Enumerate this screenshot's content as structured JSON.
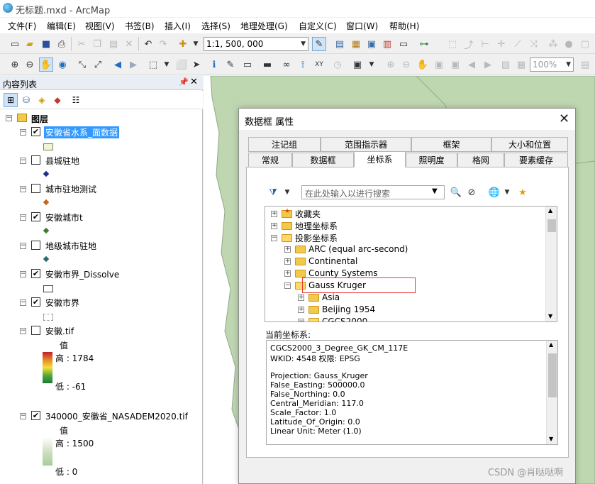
{
  "window": {
    "title": "无标题.mxd - ArcMap"
  },
  "menu": [
    "文件(F)",
    "编辑(E)",
    "视图(V)",
    "书签(B)",
    "插入(I)",
    "选择(S)",
    "地理处理(G)",
    "自定义(C)",
    "窗口(W)",
    "帮助(H)"
  ],
  "toolbar": {
    "scale": "1:1, 500, 000",
    "zoom_percent": "100%"
  },
  "toc": {
    "title": "内容列表",
    "root": "图层",
    "layers": [
      {
        "name": "安徽省水系_面数据",
        "checked": "✔",
        "selected": true
      },
      {
        "name": "县城驻地",
        "checked": ""
      },
      {
        "name": "城市驻地测试",
        "checked": ""
      },
      {
        "name": "安徽城市t",
        "checked": "✔"
      },
      {
        "name": "地级城市驻地",
        "checked": ""
      },
      {
        "name": "安徽市界_Dissolve",
        "checked": "✔"
      },
      {
        "name": "安徽市界",
        "checked": "✔"
      },
      {
        "name": "安徽.tif",
        "checked": "",
        "value_label": "值",
        "high": "高 : 1784",
        "low": "低 : -61"
      },
      {
        "name": "340000_安徽省_NASADEM2020.tif",
        "checked": "✔",
        "value_label": "值",
        "high": "高 : 1500",
        "low": "低 : 0"
      }
    ]
  },
  "dialog": {
    "title": "数据框 属性",
    "tabs_row1": [
      "注记组",
      "范围指示器",
      "框架",
      "大小和位置"
    ],
    "tabs_row2": [
      "常规",
      "数据框",
      "坐标系",
      "照明度",
      "格网",
      "要素缓存"
    ],
    "active_tab": "坐标系",
    "search_placeholder": "在此处输入以进行搜索",
    "tree": [
      {
        "label": "收藏夹",
        "level": 0,
        "expander": "+"
      },
      {
        "label": "地理坐标系",
        "level": 0,
        "expander": "+"
      },
      {
        "label": "投影坐标系",
        "level": 0,
        "expander": "−"
      },
      {
        "label": "ARC (equal arc-second)",
        "level": 1,
        "expander": "+"
      },
      {
        "label": "Continental",
        "level": 1,
        "expander": "+"
      },
      {
        "label": "County Systems",
        "level": 1,
        "expander": "+"
      },
      {
        "label": "Gauss Kruger",
        "level": 1,
        "expander": "−"
      },
      {
        "label": "Asia",
        "level": 2,
        "expander": "+"
      },
      {
        "label": "Beijing 1954",
        "level": 2,
        "expander": "+"
      },
      {
        "label": "CGCS2000",
        "level": 2,
        "expander": "−"
      }
    ],
    "current_label": "当前坐标系:",
    "current_crs": [
      "CGCS2000_3_Degree_GK_CM_117E",
      "WKID: 4548 权限: EPSG",
      "",
      "Projection: Gauss_Kruger",
      "False_Easting: 500000.0",
      "False_Northing: 0.0",
      "Central_Meridian: 117.0",
      "Scale_Factor: 1.0",
      "Latitude_Of_Origin: 0.0",
      "Linear Unit: Meter (1.0)"
    ]
  },
  "watermark": "CSDN @肖哒哒啊",
  "colors": {
    "selection": "#3399ff",
    "map_fill": "#bfd7b1",
    "highlight_box": "#e53935"
  }
}
